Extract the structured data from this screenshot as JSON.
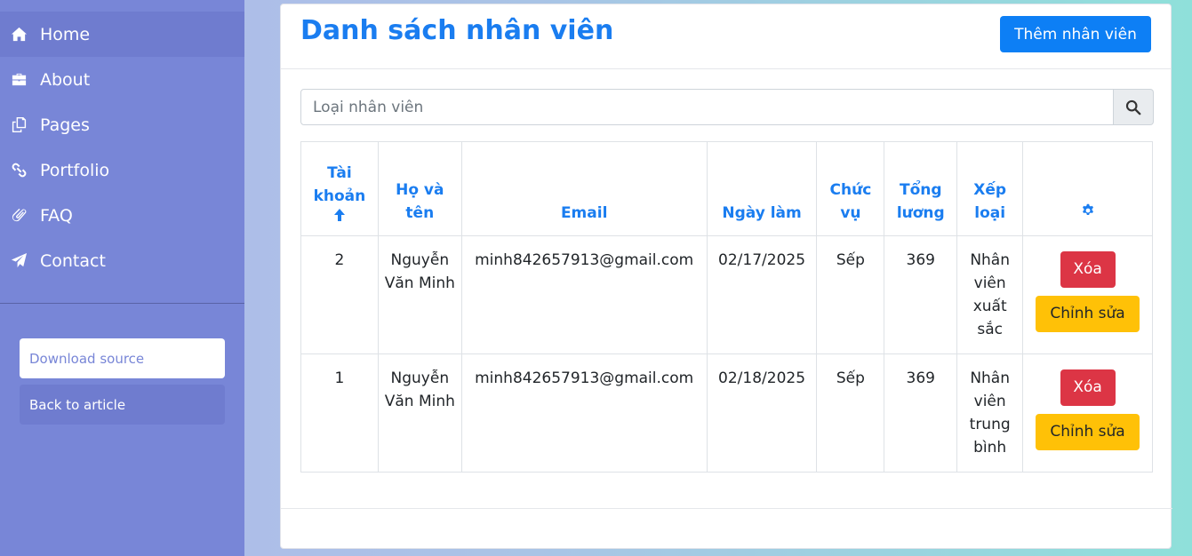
{
  "sidebar": {
    "items": [
      {
        "label": "Home",
        "icon": "home-icon"
      },
      {
        "label": "About",
        "icon": "briefcase-icon"
      },
      {
        "label": "Pages",
        "icon": "copy-icon"
      },
      {
        "label": "Portfolio",
        "icon": "link-icon"
      },
      {
        "label": "FAQ",
        "icon": "paperclip-icon"
      },
      {
        "label": "Contact",
        "icon": "paper-plane-icon"
      }
    ],
    "download_label": "Download source",
    "back_label": "Back to article"
  },
  "header": {
    "title": "Danh sách nhân viên",
    "add_button": "Thêm nhân viên"
  },
  "search": {
    "placeholder": "Loại nhân viên"
  },
  "table": {
    "headers": [
      "Tài khoản",
      "Họ và tên",
      "Email",
      "Ngày làm",
      "Chức vụ",
      "Tổng lương",
      "Xếp loại"
    ],
    "rows": [
      {
        "account": "2",
        "name": "Nguyễn Văn Minh",
        "email": "minh842657913@gmail.com",
        "date": "02/17/2025",
        "position": "Sếp",
        "salary": "369",
        "rank": "Nhân viên xuất sắc",
        "delete": "Xóa",
        "edit": "Chỉnh sửa"
      },
      {
        "account": "1",
        "name": "Nguyễn Văn Minh",
        "email": "minh842657913@gmail.com",
        "date": "02/18/2025",
        "position": "Sếp",
        "salary": "369",
        "rank": "Nhân viên trung bình",
        "delete": "Xóa",
        "edit": "Chỉnh sửa"
      }
    ]
  },
  "colors": {
    "sidebar_bg": "#7886d7",
    "primary": "#0d7ff5",
    "danger": "#dc3545",
    "warning": "#ffc107"
  }
}
